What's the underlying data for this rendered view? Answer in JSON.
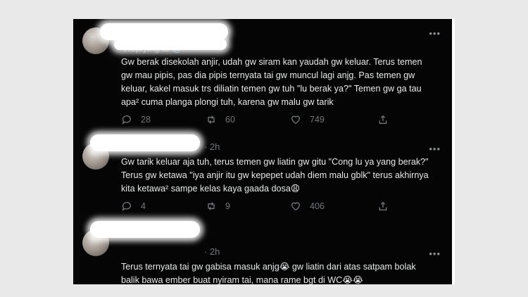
{
  "tweets": [
    {
      "replying_prefix": "Replying to ",
      "replying_handle": "@",
      "time": "",
      "more": "•••",
      "text": "Gw berak disekolah anjir, udah gw siram kan yaudah gw keluar. Terus temen gw mau pipis, pas dia pipis ternyata tai gw muncul lagi anjg. Pas temen gw keluar, kakel masuk trs diliatin temen gw tuh \"lu berak ya?\" Temen gw ga tau apa² cuma planga plongi tuh, karena gw malu gw tarik",
      "replies": "28",
      "retweets": "60",
      "likes": "749"
    },
    {
      "time": "· 2h",
      "more": "•••",
      "text": "Gw tarik keluar aja tuh, terus temen gw liatin gw gitu \"Cong lu ya yang berak?\" Terus gw ketawa \"iya anjir itu gw kepepet udah diem malu gblk\" terus akhirnya kita ketawa² sampe kelas kaya gaada dosa😩",
      "replies": "4",
      "retweets": "9",
      "likes": "406"
    },
    {
      "time": "· 2h",
      "more": "•••",
      "text": "Terus ternyata tai gw gabisa masuk anjg😭 gw liatin dari atas satpam bolak balik bawa ember buat nyiram tai, mana rame bgt di WC😭😭",
      "replies": "",
      "retweets": "",
      "likes": ""
    }
  ],
  "colors": {
    "background": "#050505",
    "text": "#e7e9ea",
    "secondary": "#71767b",
    "link": "#1d9bf0"
  },
  "icons": [
    "reply-icon",
    "retweet-icon",
    "like-icon",
    "share-icon",
    "more-icon"
  ]
}
